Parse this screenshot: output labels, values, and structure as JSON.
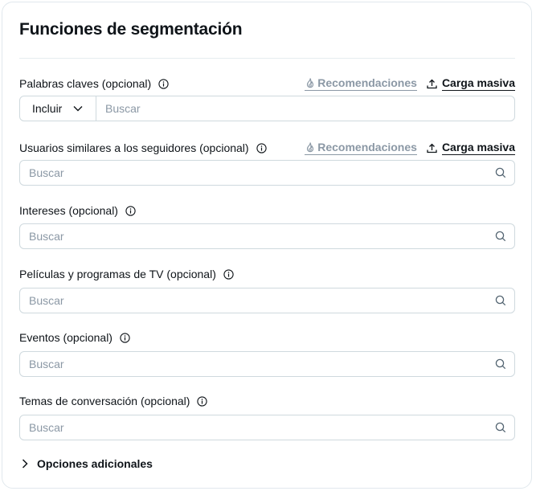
{
  "section": {
    "title": "Funciones de segmentación",
    "more_options": "Opciones adicionales"
  },
  "actions": {
    "recommendations": "Recomendaciones",
    "bulk_upload": "Carga masiva"
  },
  "fields": {
    "keywords": {
      "label": "Palabras claves",
      "optional": "(opcional)",
      "mode": "Incluir",
      "placeholder": "Buscar"
    },
    "lookalikes": {
      "label": "Usuarios similares a los seguidores",
      "optional": "(opcional)",
      "placeholder": "Buscar"
    },
    "interests": {
      "label": "Intereses",
      "optional": "(opcional)",
      "placeholder": "Buscar"
    },
    "movies_tv": {
      "label": "Películas y programas de TV",
      "optional": "(opcional)",
      "placeholder": "Buscar"
    },
    "events": {
      "label": "Eventos",
      "optional": "(opcional)",
      "placeholder": "Buscar"
    },
    "topics": {
      "label": "Temas de conversación",
      "optional": "(opcional)",
      "placeholder": "Buscar"
    }
  },
  "colors": {
    "text": "#0f1419",
    "muted": "#8b98a5",
    "border": "#cfd9de"
  }
}
